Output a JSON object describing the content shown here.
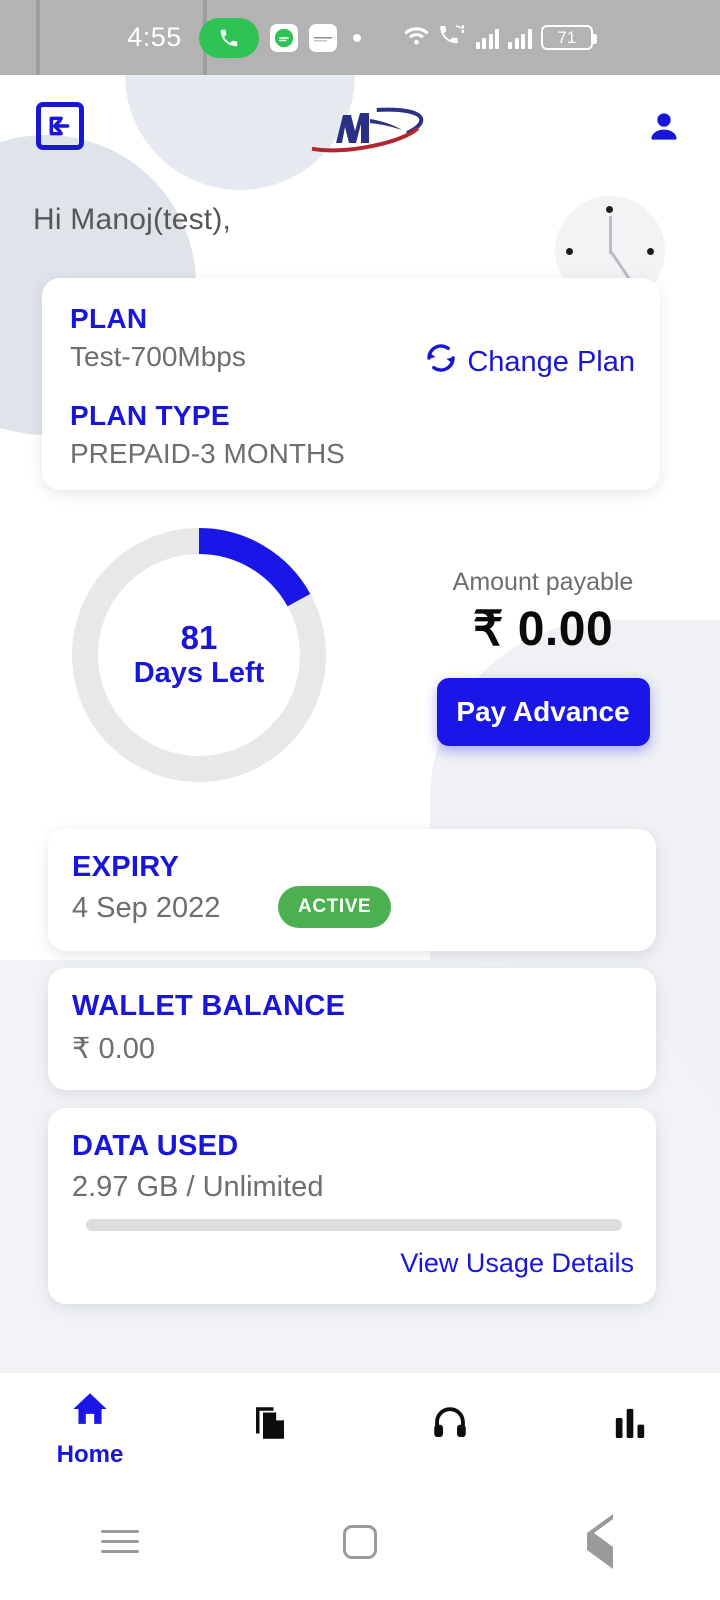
{
  "statusbar": {
    "time": "4:55",
    "battery_percent": "71",
    "icons": [
      "phone-call-active",
      "whatsapp",
      "app-white",
      "dot",
      "wifi",
      "vowifi",
      "signal-1",
      "signal-2",
      "battery"
    ]
  },
  "header": {
    "back_icon": "exit-arrow-icon",
    "logo_alt": "M logo",
    "profile_icon": "person-icon"
  },
  "greeting": "Hi Manoj(test),",
  "plan_card": {
    "plan_label": "PLAN",
    "plan_value": "Test-700Mbps",
    "plan_type_label": "PLAN TYPE",
    "plan_type_value": "PREPAID-3 MONTHS",
    "change_plan_label": "Change Plan",
    "change_plan_icon": "refresh-icon"
  },
  "ring": {
    "days": "81",
    "sub": "Days Left",
    "percent": 17,
    "track_color": "#e8e8e8",
    "arc_color": "#1a16e8"
  },
  "payment": {
    "label": "Amount payable",
    "amount": "₹ 0.00",
    "button_label": "Pay Advance"
  },
  "expiry_card": {
    "label": "EXPIRY",
    "value": "4 Sep 2022",
    "badge": "ACTIVE",
    "badge_color": "#4caf50"
  },
  "wallet_card": {
    "label": "WALLET BALANCE",
    "value": "₹ 0.00"
  },
  "data_card": {
    "label": "DATA USED",
    "value": "2.97 GB / Unlimited",
    "progress_percent": 0,
    "link_label": "View Usage Details"
  },
  "bottom_nav": {
    "items": [
      {
        "label": "Home",
        "icon": "home-icon",
        "active": true
      },
      {
        "label": "",
        "icon": "documents-icon",
        "active": false
      },
      {
        "label": "",
        "icon": "headset-icon",
        "active": false
      },
      {
        "label": "",
        "icon": "bar-chart-icon",
        "active": false
      }
    ]
  },
  "android_nav": {
    "recents_icon": "hamburger-icon",
    "home_icon": "square-icon",
    "back_icon": "triangle-back-icon"
  },
  "theme": {
    "accent": "#1a16e8",
    "accent_text": "#1a16d8",
    "muted_text": "#6e6e6e",
    "page_bg": "#ffffff"
  }
}
